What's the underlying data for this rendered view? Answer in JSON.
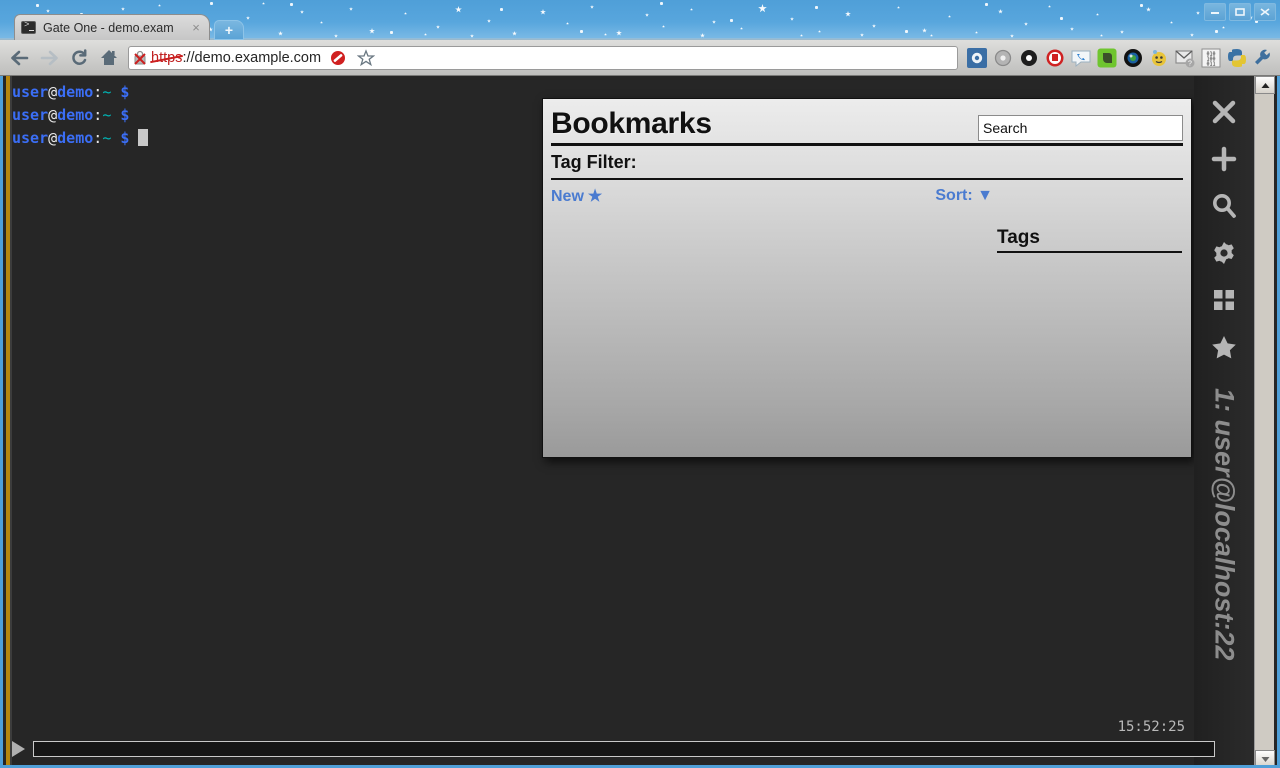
{
  "window": {
    "controls": [
      {
        "name": "minimize",
        "label": "Minimize"
      },
      {
        "name": "maximize",
        "label": "Maximize"
      },
      {
        "name": "close",
        "label": "Close"
      }
    ]
  },
  "browser": {
    "tab": {
      "title": "Gate One - demo.exam",
      "close_label": "×",
      "favicon": "terminal-icon"
    },
    "new_tab_label": "+",
    "nav": {
      "back": "←",
      "forward": "→",
      "reload": "C",
      "home": "⌂"
    },
    "url": {
      "scheme": "https",
      "rest": "://demo.example.com",
      "security_icon": "broken-lock-icon",
      "full": "https://demo.example.com"
    },
    "url_right_icons": [
      "blocked-icon",
      "bookmark-star-icon"
    ],
    "extensions": [
      "blue-gear-icon",
      "gray-gear-icon",
      "black-gear-icon",
      "stop-hand-icon",
      "phone-bubble-icon",
      "evernote-icon",
      "camera-lens-icon",
      "yellow-face-icon",
      "mail-question-icon",
      "binary-qr-icon",
      "python-icon",
      "wrench-icon"
    ]
  },
  "terminal": {
    "lines": [
      {
        "user": "user",
        "at": "@",
        "host": "demo",
        "colon": ":",
        "path": "~",
        "dollar": "$",
        "command": "",
        "cursor": false
      },
      {
        "user": "user",
        "at": "@",
        "host": "demo",
        "colon": ":",
        "path": "~",
        "dollar": "$",
        "command": "",
        "cursor": false
      },
      {
        "user": "user",
        "at": "@",
        "host": "demo",
        "colon": ":",
        "path": "~",
        "dollar": "$",
        "command": "",
        "cursor": true
      }
    ],
    "timestamp": "15:52:25"
  },
  "bookmarks_panel": {
    "title": "Bookmarks",
    "search_value": "Search",
    "search_placeholder": "Search",
    "tag_filter_label": "Tag Filter:",
    "new_label": "New",
    "new_star": "★",
    "sort_label": "Sort:",
    "sort_arrow": "▼",
    "tags_heading": "Tags",
    "bookmark_items": [],
    "tag_items": []
  },
  "sidebar": {
    "icons": [
      {
        "name": "close-panel-icon",
        "label": "Close"
      },
      {
        "name": "new-terminal-icon",
        "label": "New"
      },
      {
        "name": "search-icon",
        "label": "Search"
      },
      {
        "name": "gear-icon",
        "label": "Settings"
      },
      {
        "name": "grid-icon",
        "label": "Panels"
      },
      {
        "name": "star-icon",
        "label": "Bookmarks"
      }
    ],
    "session_label": "1: user@localhost:22"
  },
  "playback": {
    "play_label": "▶",
    "progress_percent": 0
  },
  "colors": {
    "accent_blue": "#4f9fd8",
    "terminal_bg": "#262626",
    "prompt_blue": "#3b6ef5",
    "link_blue": "#4a7bd0",
    "panel_top": "#ececec",
    "panel_bottom": "#9a9a9a"
  }
}
